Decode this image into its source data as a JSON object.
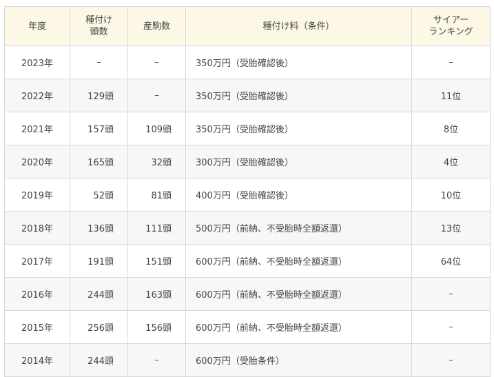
{
  "headers": {
    "year": "年度",
    "breeding_count_line1": "種付け",
    "breeding_count_line2": "頭数",
    "foal_count": "産駒数",
    "fee": "種付け料（条件）",
    "ranking_line1": "サイアー",
    "ranking_line2": "ランキング"
  },
  "rows": [
    {
      "year": "2023年",
      "breeding": "–",
      "foals": "–",
      "fee": "350万円（受胎確認後）",
      "rank": "–"
    },
    {
      "year": "2022年",
      "breeding": "129頭",
      "foals": "–",
      "fee": "350万円（受胎確認後）",
      "rank": "11位"
    },
    {
      "year": "2021年",
      "breeding": "157頭",
      "foals": "109頭",
      "fee": "350万円（受胎確認後）",
      "rank": "8位"
    },
    {
      "year": "2020年",
      "breeding": "165頭",
      "foals": "32頭",
      "fee": "300万円（受胎確認後）",
      "rank": "4位"
    },
    {
      "year": "2019年",
      "breeding": "52頭",
      "foals": "81頭",
      "fee": "400万円（受胎確認後）",
      "rank": "10位"
    },
    {
      "year": "2018年",
      "breeding": "136頭",
      "foals": "111頭",
      "fee": "500万円（前納、不受胎時全額返還）",
      "rank": "13位"
    },
    {
      "year": "2017年",
      "breeding": "191頭",
      "foals": "151頭",
      "fee": "600万円（前納、不受胎時全額返還）",
      "rank": "64位"
    },
    {
      "year": "2016年",
      "breeding": "244頭",
      "foals": "163頭",
      "fee": "600万円（前納、不受胎時全額返還）",
      "rank": "–"
    },
    {
      "year": "2015年",
      "breeding": "256頭",
      "foals": "156頭",
      "fee": "600万円（前納、不受胎時全額返還）",
      "rank": "–"
    },
    {
      "year": "2014年",
      "breeding": "244頭",
      "foals": "–",
      "fee": "600万円（受胎条件）",
      "rank": "–"
    }
  ]
}
